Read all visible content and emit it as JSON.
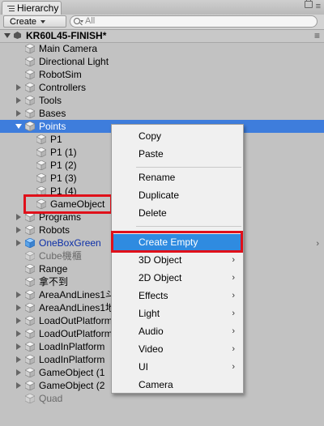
{
  "panel": {
    "tab_label": "Hierarchy"
  },
  "toolbar": {
    "create_label": "Create",
    "search_placeholder": "All"
  },
  "scene": {
    "name": "KR60L45-FINISH*"
  },
  "tree": {
    "items": [
      {
        "label": "Main Camera"
      },
      {
        "label": "Directional Light"
      },
      {
        "label": "RobotSim"
      },
      {
        "label": "Controllers"
      },
      {
        "label": "Tools"
      },
      {
        "label": "Bases"
      },
      {
        "label": "Points"
      },
      {
        "label": "P1"
      },
      {
        "label": "P1 (1)"
      },
      {
        "label": "P1 (2)"
      },
      {
        "label": "P1 (3)"
      },
      {
        "label": "P1 (4)"
      },
      {
        "label": "GameObject"
      },
      {
        "label": "Programs"
      },
      {
        "label": "Robots"
      },
      {
        "label": "OneBoxGreen"
      },
      {
        "label": "Cube機櫃"
      },
      {
        "label": "Range"
      },
      {
        "label": "拿不到"
      },
      {
        "label": "AreaAndLines1斗"
      },
      {
        "label": "AreaAndLines1地"
      },
      {
        "label": "LoadOutPlatform"
      },
      {
        "label": "LoadOutPlatform"
      },
      {
        "label": "LoadInPlatform"
      },
      {
        "label": "LoadInPlatform"
      },
      {
        "label": "GameObject (1"
      },
      {
        "label": "GameObject (2"
      },
      {
        "label": "Quad"
      }
    ]
  },
  "context_menu": {
    "items": [
      {
        "label": "Copy"
      },
      {
        "label": "Paste"
      },
      {
        "label": "Rename"
      },
      {
        "label": "Duplicate"
      },
      {
        "label": "Delete"
      },
      {
        "label": "Create Empty"
      },
      {
        "label": "3D Object"
      },
      {
        "label": "2D Object"
      },
      {
        "label": "Effects"
      },
      {
        "label": "Light"
      },
      {
        "label": "Audio"
      },
      {
        "label": "Video"
      },
      {
        "label": "UI"
      },
      {
        "label": "Camera"
      }
    ]
  },
  "colors": {
    "selection": "#3e7ddc",
    "menu_highlight": "#2f8be0",
    "annotation_border": "#e0101a",
    "prefab_text": "#0c2fa8"
  }
}
